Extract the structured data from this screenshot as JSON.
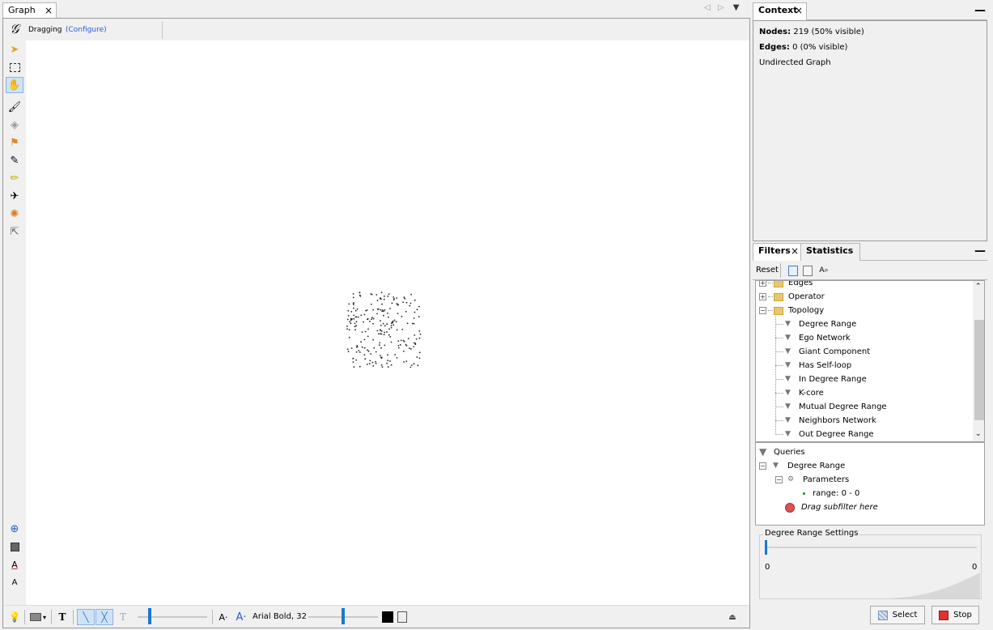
{
  "graph": {
    "tab_label": "Graph",
    "close_glyph": "×",
    "nav_prev": "◁",
    "nav_next": "▷",
    "nav_menu": "▼",
    "mode_label": "Dragging",
    "configure_link": "(Configure)",
    "font_label": "Arial Bold, 32",
    "text_tool_glyph": "T",
    "font_decrease_glyph": "A·",
    "font_increase_glyph": "A·",
    "eject_glyph": "⏏",
    "left_tools": [
      "gephi-logo-icon",
      "pointer-icon",
      "rectangle-select-icon",
      "drag-hand-icon",
      "brush-icon",
      "diamond-icon",
      "shortest-path-icon",
      "pencil-icon",
      "edge-pencil-icon",
      "airplane-icon",
      "heat-icon",
      "help-pointer-icon",
      "zoom-icon",
      "background-color-icon",
      "label-color-icon",
      "label-size-icon"
    ]
  },
  "context": {
    "tab_label": "Context",
    "nodes_label": "Nodes:",
    "nodes_value": "219 (50% visible)",
    "edges_label": "Edges:",
    "edges_value": "0 (0% visible)",
    "graph_type": "Undirected Graph",
    "minimize": "—"
  },
  "filters": {
    "tab_label": "Filters",
    "stats_tab_label": "Statistics",
    "minimize": "—",
    "reset_label": "Reset",
    "library": {
      "folders": [
        "Edges",
        "Operator",
        "Topology"
      ],
      "topology_items": [
        "Degree Range",
        "Ego Network",
        "Giant Component",
        "Has Self-loop",
        "In Degree Range",
        "K-core",
        "Mutual Degree Range",
        "Neighbors Network",
        "Out Degree Range"
      ]
    },
    "queries": {
      "root_label": "Queries",
      "filter_label": "Degree Range",
      "params_label": "Parameters",
      "range_label": "range: 0 - 0",
      "drag_hint": "Drag subfilter here"
    },
    "settings": {
      "title": "Degree Range Settings",
      "min_label": "0",
      "max_label": "0",
      "slider_fraction": 0
    },
    "select_label": "Select",
    "stop_label": "Stop"
  },
  "colors": {
    "accent": "#1978d2",
    "link": "#2a5bd7",
    "stop": "#e03030"
  }
}
